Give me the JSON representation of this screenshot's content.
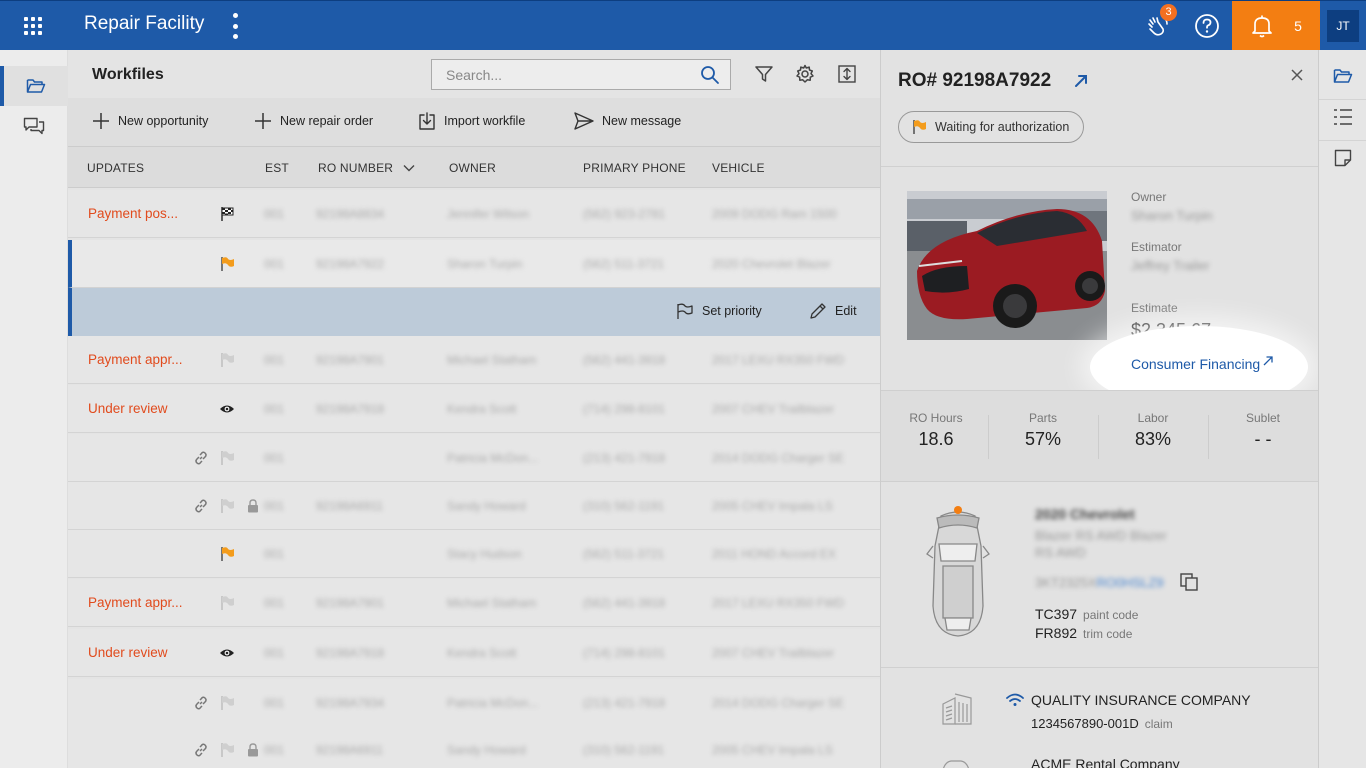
{
  "app": {
    "title": "Repair Facility",
    "hand_badge": "3",
    "notifications_count": "5",
    "user_initials": "JT",
    "accent": "#1e5aa8",
    "alert": "#f37e12"
  },
  "workfiles": {
    "title": "Workfiles",
    "search_placeholder": "Search...",
    "actions": {
      "new_opportunity": "New opportunity",
      "new_repair_order": "New repair order",
      "import_workfile": "Import workfile",
      "new_message": "New message"
    },
    "columns": {
      "updates": "UPDATES",
      "est": "EST",
      "ro_number": "RO NUMBER",
      "owner": "OWNER",
      "primary_phone": "PRIMARY PHONE",
      "vehicle": "VEHICLE"
    },
    "row_actions": {
      "set_priority": "Set priority",
      "edit": "Edit"
    },
    "rows": [
      {
        "update": "Payment pos...",
        "est": "001",
        "ro": "92198A8834",
        "owner": "Jennifer Wilson",
        "phone": "(562) 923-2781",
        "vehicle": "2009 DODG Ram 1500"
      },
      {
        "update": "",
        "est": "001",
        "ro": "92198A7922",
        "owner": "Sharon Turpin",
        "phone": "(562) 511-3721",
        "vehicle": "2020 Chevrolet Blazer"
      },
      {
        "update": "Payment appr...",
        "est": "001",
        "ro": "92198A7901",
        "owner": "Michael Statham",
        "phone": "(562) 441-3918",
        "vehicle": "2017 LEXU RX350 FWD"
      },
      {
        "update": "Under review",
        "est": "001",
        "ro": "92198A7918",
        "owner": "Kendra Scott",
        "phone": "(714) 298-8101",
        "vehicle": "2007 CHEV Trailblazer"
      },
      {
        "update": "",
        "est": "001",
        "ro": "",
        "owner": "Patricia McDon...",
        "phone": "(213) 421-7918",
        "vehicle": "2014 DODG Charger SE"
      },
      {
        "update": "",
        "est": "001",
        "ro": "92198A6911",
        "owner": "Sandy Howard",
        "phone": "(310) 562-1191",
        "vehicle": "2005 CHEV Impala LS"
      },
      {
        "update": "",
        "est": "001",
        "ro": "",
        "owner": "Stacy Hudson",
        "phone": "(562) 511-3721",
        "vehicle": "2011 HOND Accord EX"
      },
      {
        "update": "Payment appr...",
        "est": "001",
        "ro": "92198A7901",
        "owner": "Michael Statham",
        "phone": "(562) 441-3918",
        "vehicle": "2017 LEXU RX350 FWD"
      },
      {
        "update": "Under review",
        "est": "001",
        "ro": "92198A7918",
        "owner": "Kendra Scott",
        "phone": "(714) 298-8101",
        "vehicle": "2007 CHEV Trailblazer"
      },
      {
        "update": "",
        "est": "001",
        "ro": "92198A7934",
        "owner": "Patricia McDon...",
        "phone": "(213) 421-7918",
        "vehicle": "2014 DODG Charger SE"
      },
      {
        "update": "",
        "est": "001",
        "ro": "92198A6911",
        "owner": "Sandy Howard",
        "phone": "(310) 562-1191",
        "vehicle": "2005 CHEV Impala LS"
      }
    ]
  },
  "detail": {
    "ro_title": "RO# 92198A7922",
    "status": "Waiting for authorization",
    "owner_label": "Owner",
    "owner_value": "Sharon Turpin",
    "estimator_label": "Estimator",
    "estimator_value": "Jeffrey Trailer",
    "estimate_label": "Estimate",
    "estimate_value": "$2,345.67",
    "financing_link": "Consumer Financing",
    "metrics": [
      {
        "label": "RO Hours",
        "value": "18.6"
      },
      {
        "label": "Parts",
        "value": "57%"
      },
      {
        "label": "Labor",
        "value": "83%"
      },
      {
        "label": "Sublet",
        "value": "- -"
      }
    ],
    "vehicle_title": "2020 Chevrolet",
    "vehicle_sub1": "Blazer RS AWD Blazer",
    "vehicle_sub2": "RS AWD",
    "vin_prefix": "3KT2325X",
    "vin_suffix": "RO0HSLZ9",
    "paint_code": "TC397",
    "paint_code_label": "paint code",
    "trim_code": "FR892",
    "trim_code_label": "trim code",
    "insurance_name": "QUALITY INSURANCE COMPANY",
    "claim_number": "1234567890-001D",
    "claim_label": "claim",
    "rental_name": "ACME Rental Company"
  }
}
